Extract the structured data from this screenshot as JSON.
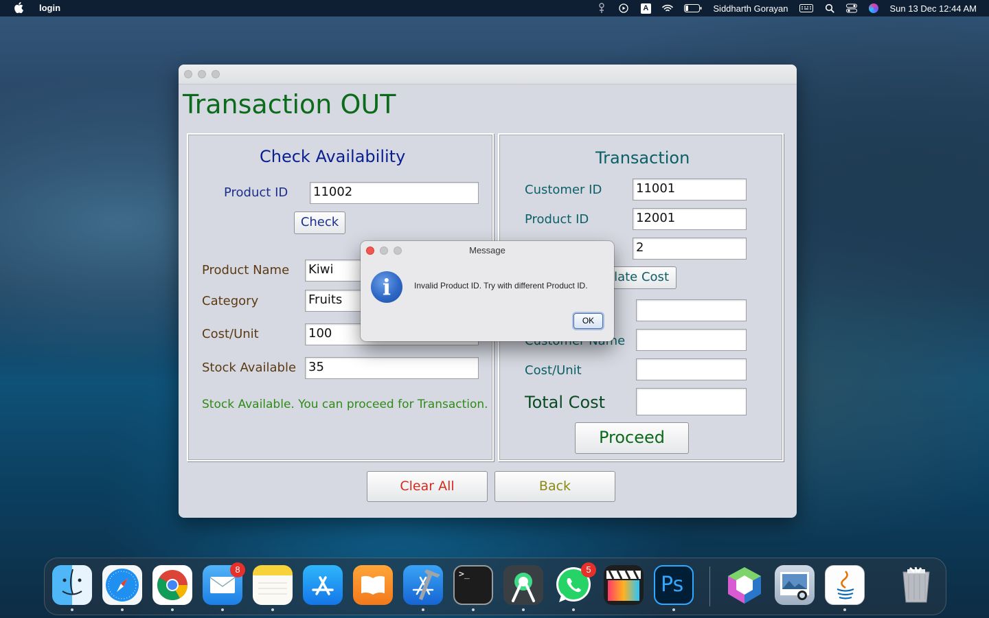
{
  "menubar": {
    "app_name": "login",
    "user": "Siddharth Gorayan",
    "datetime": "Sun 13 Dec  12:44 AM",
    "keyboard_letter": "A"
  },
  "window": {
    "title": "Transaction OUT",
    "check_panel": {
      "title": "Check Availability",
      "product_id_label": "Product ID",
      "product_id_value": "11002",
      "check_button": "Check",
      "product_name_label": "Product Name",
      "product_name_value": "Kiwi",
      "category_label": "Category",
      "category_value": "Fruits",
      "cost_unit_label": "Cost/Unit",
      "cost_unit_value": "100",
      "stock_label": "Stock Available",
      "stock_value": "35",
      "status_message": "Stock Available. You can proceed for Transaction."
    },
    "transaction_panel": {
      "title": "Transaction",
      "customer_id_label": "Customer ID",
      "customer_id_value": "11001",
      "product_id_label": "Product ID",
      "product_id_value": "12001",
      "quantity_value": "2",
      "calculate_button_visible": "ulate Cost",
      "customer_name_label_visible": "Customer Name",
      "cost_unit_label": "Cost/Unit",
      "total_cost_label": "Total Cost",
      "proceed_button": "Proceed"
    },
    "clear_button": "Clear All",
    "back_button": "Back"
  },
  "dialog": {
    "title": "Message",
    "message": "Invalid Product ID. Try with different Product ID.",
    "ok_button": "OK"
  },
  "dock": {
    "mail_badge": "8",
    "whatsapp_badge": "5",
    "terminal_prompt": ">_",
    "photoshop_label": "Ps"
  },
  "colors": {
    "title_green": "#0b6b1a",
    "panel_blue_title": "#0a1f8f",
    "label_blue": "#1b2f8a",
    "label_brown": "#5a3a12",
    "message_green": "#2e8b16",
    "clear_red": "#d42a1c",
    "back_olive": "#8a8a10",
    "teal_label": "#0c5f66"
  }
}
